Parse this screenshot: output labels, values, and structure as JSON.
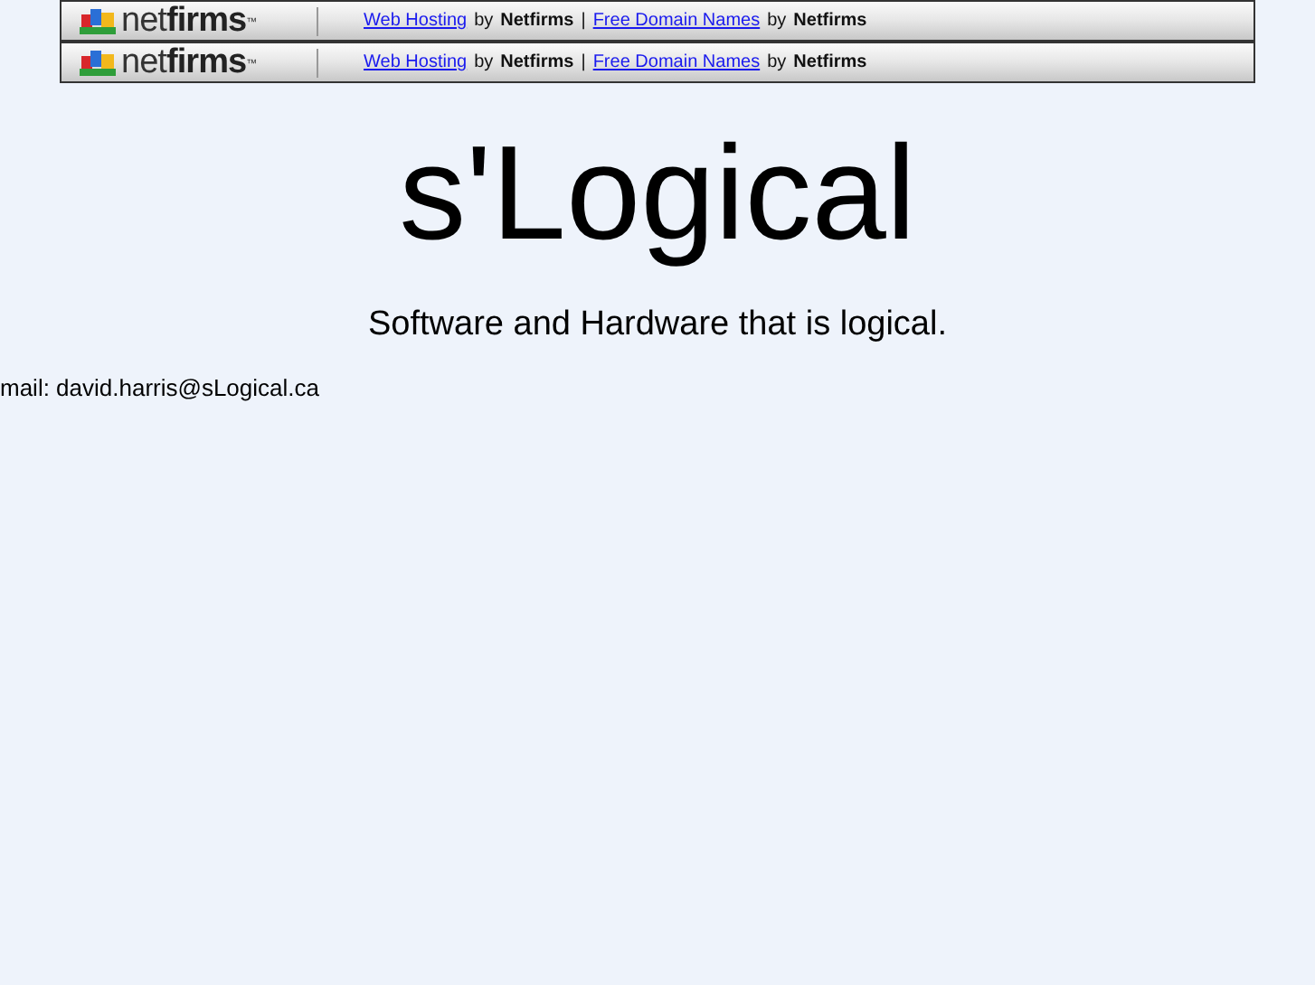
{
  "banners": [
    {
      "logo": {
        "light": "net",
        "bold": "firms",
        "mark": "™"
      },
      "parts": [
        {
          "kind": "link",
          "text": "Web Hosting"
        },
        {
          "kind": "plain",
          "text": "by"
        },
        {
          "kind": "bold",
          "text": "Netfirms"
        },
        {
          "kind": "plain",
          "text": "|"
        },
        {
          "kind": "link",
          "text": "Free Domain Names"
        },
        {
          "kind": "plain",
          "text": "by"
        },
        {
          "kind": "bold",
          "text": "Netfirms"
        }
      ]
    },
    {
      "logo": {
        "light": "net",
        "bold": "firms",
        "mark": "™"
      },
      "parts": [
        {
          "kind": "link",
          "text": "Web Hosting"
        },
        {
          "kind": "plain",
          "text": "by"
        },
        {
          "kind": "bold",
          "text": "Netfirms"
        },
        {
          "kind": "plain",
          "text": "|"
        },
        {
          "kind": "link",
          "text": "Free Domain Names"
        },
        {
          "kind": "plain",
          "text": "by"
        },
        {
          "kind": "bold",
          "text": "Netfirms"
        }
      ]
    }
  ],
  "title": "s'Logical",
  "tagline": "Software and Hardware that is logical.",
  "contact": "mail: david.harris@sLogical.ca"
}
